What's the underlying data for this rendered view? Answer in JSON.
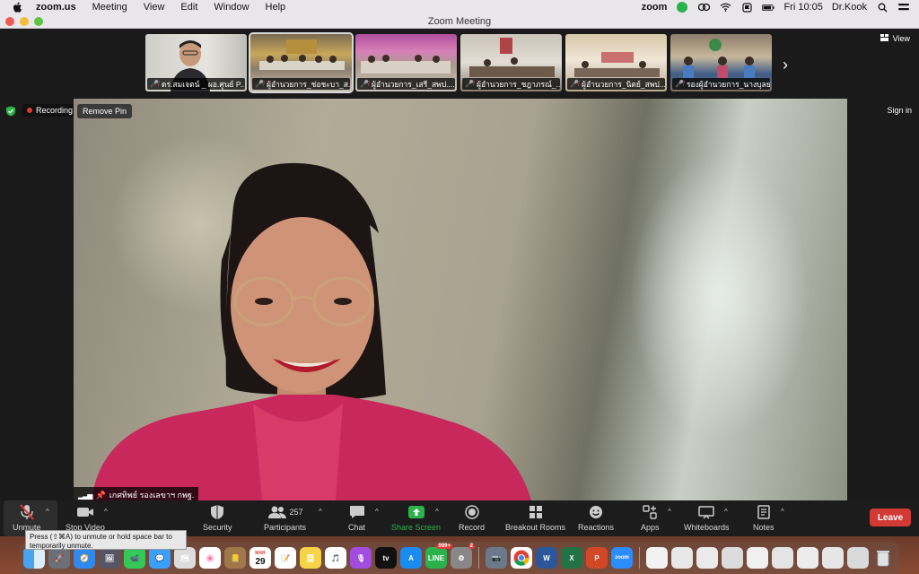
{
  "menubar": {
    "app_name": "zoom.us",
    "items": [
      "Meeting",
      "View",
      "Edit",
      "Window",
      "Help"
    ],
    "tray_zoom": "zoom",
    "clock": "Fri 10:05",
    "user": "Dr.Kook"
  },
  "window": {
    "title": "Zoom Meeting"
  },
  "thumbnails": [
    {
      "label": "ดร.สมเจตน์ _ ผอ.ศูนย์ P..."
    },
    {
      "label": "ผู้อำนวยการ_ช่อชะบา_ส..."
    },
    {
      "label": "ผู้อำนวยการ_เสรี_สพป...."
    },
    {
      "label": "ผู้อำนวยการ_ชฎาภรณ์_..."
    },
    {
      "label": "ผู้อำนวยการ_นิตย์_สพป...."
    },
    {
      "label": "รองผู้อำนวยการ_นางบุลย..."
    }
  ],
  "top_right": {
    "view_label": "View",
    "signin_label": "Sign in"
  },
  "recording_label": "Recording",
  "remove_pin_label": "Remove Pin",
  "speaker_name": "เกศทิพย์ รองเลขาฯ กพฐ.",
  "toolbar": {
    "unmute": "Unmute",
    "stop_video": "Stop Video",
    "security": "Security",
    "participants": "Participants",
    "participant_count": "257",
    "chat": "Chat",
    "share_screen": "Share Screen",
    "record": "Record",
    "breakout_rooms": "Breakout Rooms",
    "reactions": "Reactions",
    "apps": "Apps",
    "whiteboards": "Whiteboards",
    "notes": "Notes",
    "leave": "Leave"
  },
  "tooltip": "Press (⇧⌘A) to unmute or hold space bar to temporarily unmute.",
  "dock": {
    "calendar_day": "29",
    "calendar_month": "MAR",
    "tv": "tv",
    "line_badge": "999+",
    "settings_badge": "2",
    "word": "W",
    "excel": "X",
    "powerpoint": "P",
    "zoom": "zoom"
  },
  "colors": {
    "leave": "#d13b34",
    "share_screen": "#2bb24c",
    "recording_dot": "#e03a35"
  }
}
